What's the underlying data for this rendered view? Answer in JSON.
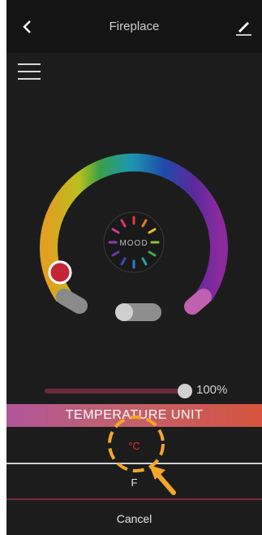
{
  "header": {
    "title": "Fireplace",
    "back_icon": "chevron-left-icon",
    "edit_icon": "pencil-edit-icon"
  },
  "menu_icon": "hamburger-menu-icon",
  "dial": {
    "center_label": "MOOD",
    "handle_color": "#c42536"
  },
  "brightness": {
    "value_label": "100%",
    "value": 100
  },
  "temperature_unit_sheet": {
    "title": "TEMPERATURE UNIT",
    "options": [
      {
        "label": "°C",
        "selected": true
      },
      {
        "label": "F",
        "selected": false
      }
    ],
    "cancel_label": "Cancel"
  },
  "colors": {
    "accent_red": "#e32d2d",
    "background": "#1c1c1c"
  }
}
